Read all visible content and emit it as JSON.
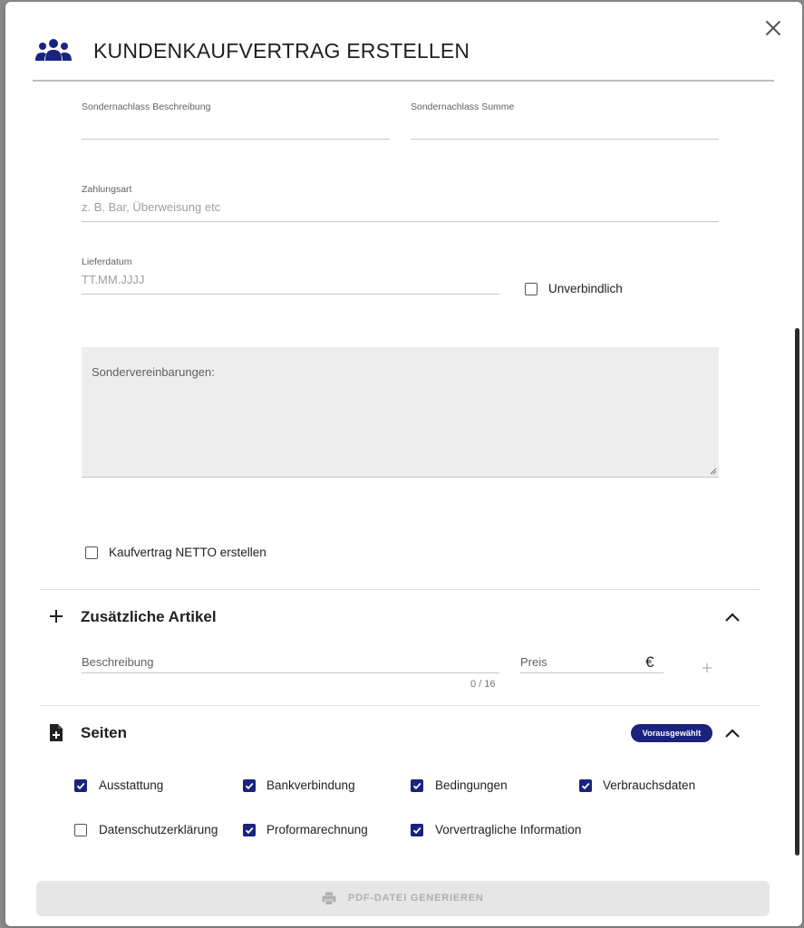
{
  "dialog": {
    "title": "KUNDENKAUFVERTRAG ERSTELLEN",
    "title_icon": "people-group-icon",
    "close_icon": "close-icon"
  },
  "form": {
    "sondernachlass_beschreibung": {
      "label": "Sondernachlass Beschreibung",
      "value": ""
    },
    "sondernachlass_summe": {
      "label": "Sondernachlass Summe",
      "value": ""
    },
    "zahlungsart": {
      "label": "Zahlungsart",
      "placeholder": "z. B. Bar, Überweisung etc"
    },
    "lieferdatum": {
      "label": "Lieferdatum",
      "placeholder": "TT.MM.JJJJ"
    },
    "unverbindlich": {
      "label": "Unverbindlich",
      "checked": false
    },
    "sondervereinbarungen": {
      "placeholder": "Sondervereinbarungen:"
    },
    "netto": {
      "label": "Kaufvertrag NETTO erstellen",
      "checked": false
    }
  },
  "zusaetzliche_artikel": {
    "title": "Zusätzliche Artikel",
    "icon": "plus-icon",
    "beschreibung_label": "Beschreibung",
    "counter": "0 / 16",
    "preis_label": "Preis",
    "currency": "€",
    "add_icon": "plus-icon"
  },
  "seiten": {
    "title": "Seiten",
    "icon": "file-plus-icon",
    "badge": "Vorausgewählt",
    "options": [
      {
        "label": "Ausstattung",
        "checked": true
      },
      {
        "label": "Bankverbindung",
        "checked": true
      },
      {
        "label": "Bedingungen",
        "checked": true
      },
      {
        "label": "Verbrauchsdaten",
        "checked": true
      },
      {
        "label": "Datenschutzerklärung",
        "checked": false
      },
      {
        "label": "Proformarechnung",
        "checked": true
      },
      {
        "label": "Vorvertragliche Information",
        "checked": true
      }
    ]
  },
  "actions": {
    "pdf_label": "PDF-DATEI GENERIEREN",
    "pdf_icon": "printer-icon"
  },
  "colors": {
    "accent": "#1a237e",
    "disabled_text": "#b0b0b0"
  }
}
